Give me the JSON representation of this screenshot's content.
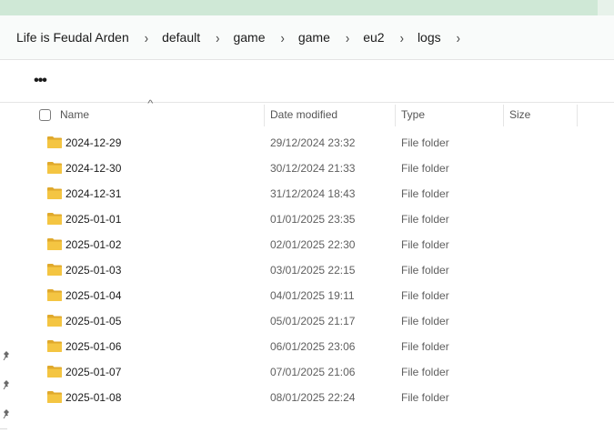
{
  "breadcrumb": [
    "Life is Feudal Arden",
    "default",
    "game",
    "game",
    "eu2",
    "logs"
  ],
  "toolbar": {
    "more_label": "•••"
  },
  "columns": {
    "name": "Name",
    "date_modified": "Date modified",
    "type": "Type",
    "size": "Size"
  },
  "files": [
    {
      "name": "2024-12-29",
      "date": "29/12/2024 23:32",
      "type": "File folder",
      "size": ""
    },
    {
      "name": "2024-12-30",
      "date": "30/12/2024 21:33",
      "type": "File folder",
      "size": ""
    },
    {
      "name": "2024-12-31",
      "date": "31/12/2024 18:43",
      "type": "File folder",
      "size": ""
    },
    {
      "name": "2025-01-01",
      "date": "01/01/2025 23:35",
      "type": "File folder",
      "size": ""
    },
    {
      "name": "2025-01-02",
      "date": "02/01/2025 22:30",
      "type": "File folder",
      "size": ""
    },
    {
      "name": "2025-01-03",
      "date": "03/01/2025 22:15",
      "type": "File folder",
      "size": ""
    },
    {
      "name": "2025-01-04",
      "date": "04/01/2025 19:11",
      "type": "File folder",
      "size": ""
    },
    {
      "name": "2025-01-05",
      "date": "05/01/2025 21:17",
      "type": "File folder",
      "size": ""
    },
    {
      "name": "2025-01-06",
      "date": "06/01/2025 23:06",
      "type": "File folder",
      "size": ""
    },
    {
      "name": "2025-01-07",
      "date": "07/01/2025 21:06",
      "type": "File folder",
      "size": ""
    },
    {
      "name": "2025-01-08",
      "date": "08/01/2025 22:24",
      "type": "File folder",
      "size": ""
    }
  ],
  "icons": {
    "file_icon": "folder-icon",
    "pin_icon": "pin-icon",
    "separator_icon": "chevron-right-icon"
  },
  "colors": {
    "folder": "#f4c542",
    "folder_dark": "#e0a92c"
  }
}
